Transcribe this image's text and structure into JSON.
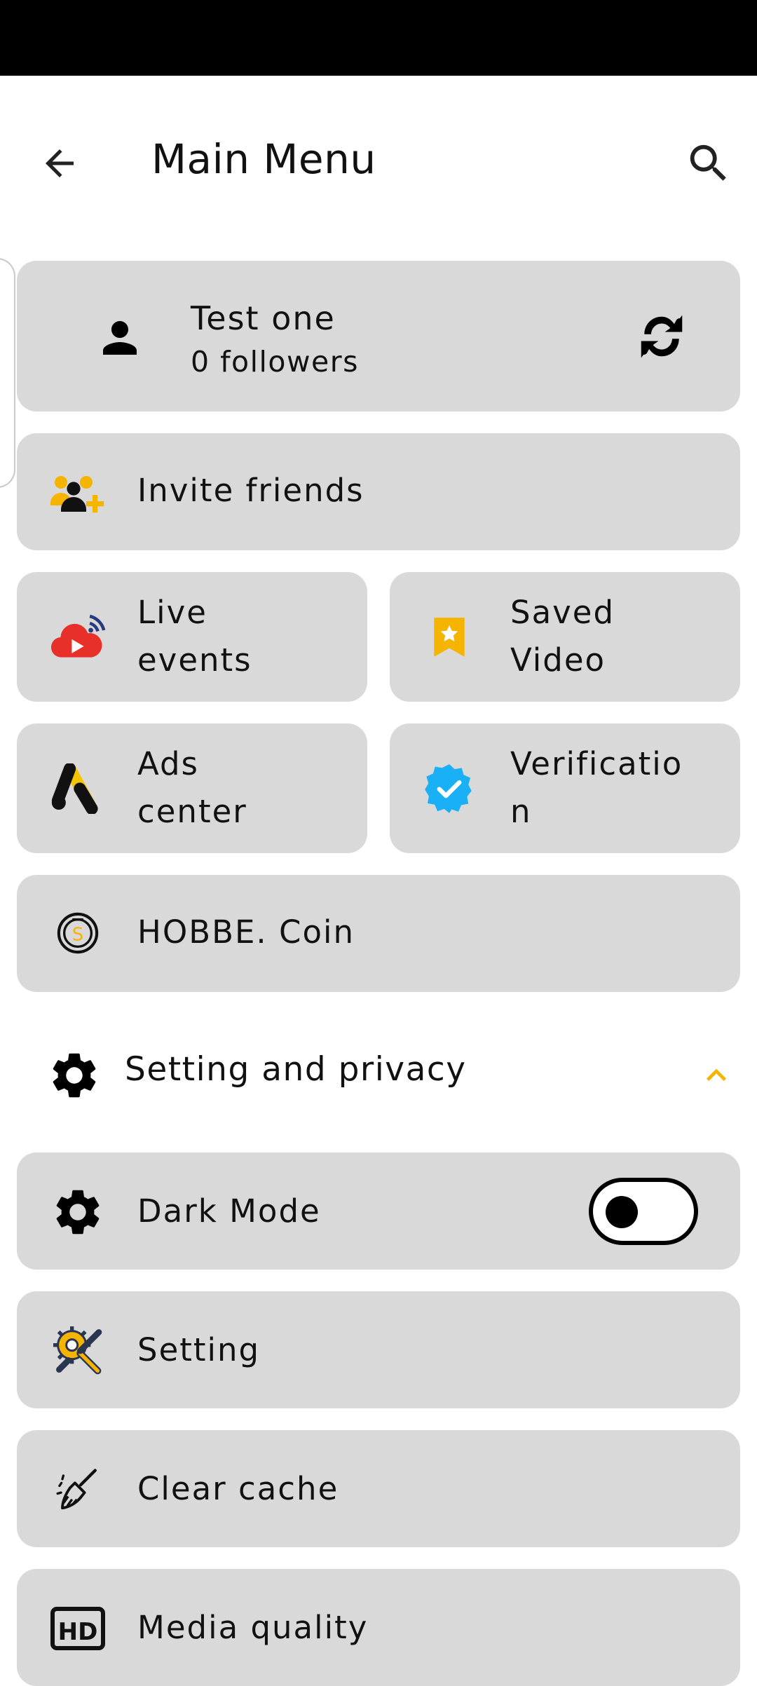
{
  "header": {
    "title": "Main Menu"
  },
  "profile": {
    "name": "Test one",
    "followers": "0 followers"
  },
  "menu": {
    "invite": "Invite friends",
    "live_line1": "Live",
    "live_line2": "events",
    "saved_line1": "Saved",
    "saved_line2": "Video",
    "ads_line1": "Ads",
    "ads_line2": "center",
    "verify_line1": "Verificatio",
    "verify_line2": "n",
    "coin": "HOBBE. Coin",
    "coin_symbol": "S"
  },
  "settings_section": {
    "title": "Setting and privacy",
    "dark_mode": "Dark Mode",
    "dark_mode_on": false,
    "setting": "Setting",
    "clear_cache": "Clear cache",
    "media_quality": "Media quality",
    "hd_badge": "HD"
  },
  "colors": {
    "card_bg": "#d9d9d9",
    "accent": "#f5b400",
    "verify_blue": "#1ab0f5",
    "live_red": "#e8302a"
  }
}
